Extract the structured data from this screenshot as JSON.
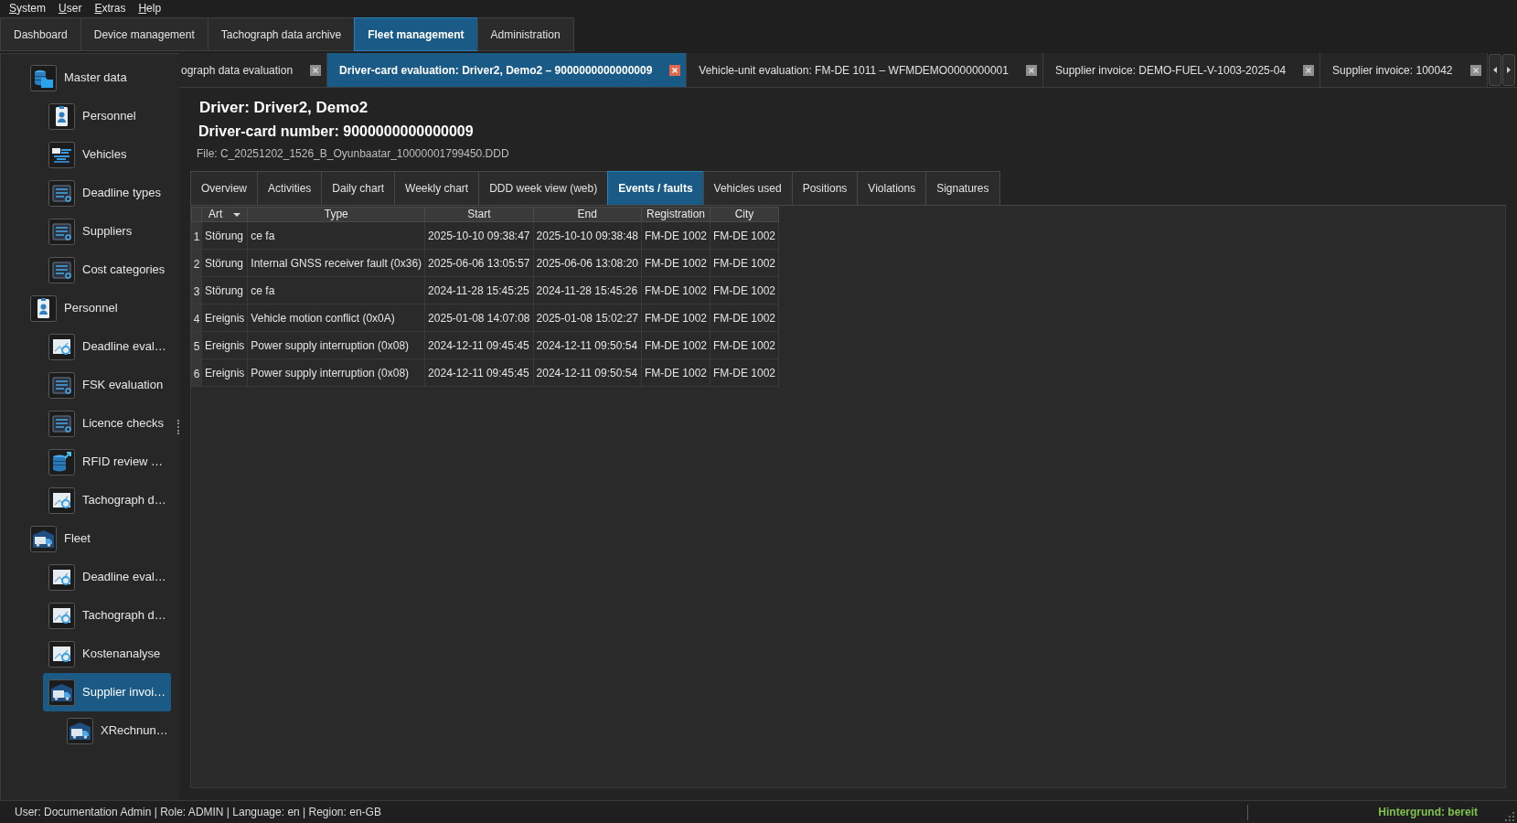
{
  "menu": [
    "System",
    "User",
    "Extras",
    "Help"
  ],
  "main_tabs": [
    {
      "label": "Dashboard",
      "selected": false
    },
    {
      "label": "Device management",
      "selected": false
    },
    {
      "label": "Tachograph data archive",
      "selected": false
    },
    {
      "label": "Fleet management",
      "selected": true
    },
    {
      "label": "Administration",
      "selected": false
    }
  ],
  "sidebar": {
    "items": [
      {
        "label": "Master data",
        "kind": "database",
        "selected": false,
        "children": [
          {
            "label": "Personnel",
            "kind": "badge",
            "selected": false
          },
          {
            "label": "Vehicles",
            "kind": "monitor",
            "selected": false
          },
          {
            "label": "Deadline types",
            "kind": "sliders",
            "selected": false
          },
          {
            "label": "Suppliers",
            "kind": "sliders",
            "selected": false
          },
          {
            "label": "Cost categories",
            "kind": "sliders",
            "selected": false
          }
        ]
      },
      {
        "label": "Personnel",
        "kind": "badge",
        "selected": false,
        "children": [
          {
            "label": "Deadline eval…",
            "kind": "chart",
            "selected": false
          },
          {
            "label": "FSK evaluation",
            "kind": "sliders",
            "selected": false
          },
          {
            "label": "Licence checks",
            "kind": "sliders",
            "selected": false
          },
          {
            "label": "RFID review …",
            "kind": "export",
            "selected": false
          },
          {
            "label": "Tachograph d…",
            "kind": "chart",
            "selected": false
          }
        ]
      },
      {
        "label": "Fleet",
        "kind": "truck",
        "selected": false,
        "children": [
          {
            "label": "Deadline eval…",
            "kind": "chart",
            "selected": false
          },
          {
            "label": "Tachograph d…",
            "kind": "chart",
            "selected": false
          },
          {
            "label": "Kostenanalyse",
            "kind": "chart",
            "selected": false
          },
          {
            "label": "Supplier invoi…",
            "kind": "truck",
            "selected": true,
            "children": [
              {
                "label": "XRechnun…",
                "kind": "truck",
                "selected": false
              }
            ]
          }
        ]
      }
    ]
  },
  "document_tabs": [
    {
      "label": "ograph data evaluation",
      "selected": false
    },
    {
      "label": "Driver-card evaluation: Driver2, Demo2 – 9000000000000009",
      "selected": true
    },
    {
      "label": "Vehicle-unit evaluation: FM-DE 1011 – WFMDEMO0000000001",
      "selected": false
    },
    {
      "label": "Supplier invoice: DEMO-FUEL-V-1003-2025-04",
      "selected": false
    },
    {
      "label": "Supplier invoice: 100042",
      "selected": false
    }
  ],
  "driver": {
    "title": "Driver: Driver2, Demo2",
    "card_number": "Driver-card number: 9000000000000009",
    "file": "File: C_20251202_1526_B_Oyunbaatar_10000001799450.DDD"
  },
  "view_tabs": [
    {
      "label": "Overview",
      "selected": false
    },
    {
      "label": "Activities",
      "selected": false
    },
    {
      "label": "Daily chart",
      "selected": false
    },
    {
      "label": "Weekly chart",
      "selected": false
    },
    {
      "label": "DDD week view (web)",
      "selected": false
    },
    {
      "label": "Events / faults",
      "selected": true
    },
    {
      "label": "Vehicles used",
      "selected": false
    },
    {
      "label": "Positions",
      "selected": false
    },
    {
      "label": "Violations",
      "selected": false
    },
    {
      "label": "Signatures",
      "selected": false
    }
  ],
  "table": {
    "columns": [
      {
        "label": "Art",
        "sorted": true
      },
      {
        "label": "Type",
        "sorted": false
      },
      {
        "label": "Start",
        "sorted": false
      },
      {
        "label": "End",
        "sorted": false
      },
      {
        "label": "Registration",
        "sorted": false
      },
      {
        "label": "City",
        "sorted": false
      }
    ],
    "rows": [
      {
        "number": "1",
        "cells": [
          "Störung",
          "ce fa",
          "2025-10-10 09:38:47",
          "2025-10-10 09:38:48",
          "FM-DE 1002",
          "FM-DE 1002"
        ]
      },
      {
        "number": "2",
        "cells": [
          "Störung",
          "Internal GNSS receiver fault (0x36)",
          "2025-06-06 13:05:57",
          "2025-06-06 13:08:20",
          "FM-DE 1002",
          "FM-DE 1002"
        ]
      },
      {
        "number": "3",
        "cells": [
          "Störung",
          "ce fa",
          "2024-11-28 15:45:25",
          "2024-11-28 15:45:26",
          "FM-DE 1002",
          "FM-DE 1002"
        ]
      },
      {
        "number": "4",
        "cells": [
          "Ereignis",
          "Vehicle motion conflict (0x0A)",
          "2025-01-08 14:07:08",
          "2025-01-08 15:02:27",
          "FM-DE 1002",
          "FM-DE 1002"
        ]
      },
      {
        "number": "5",
        "cells": [
          "Ereignis",
          "Power supply interruption (0x08)",
          "2024-12-11 09:45:45",
          "2024-12-11 09:50:54",
          "FM-DE 1002",
          "FM-DE 1002"
        ]
      },
      {
        "number": "6",
        "cells": [
          "Ereignis",
          "Power supply interruption (0x08)",
          "2024-12-11 09:45:45",
          "2024-12-11 09:50:54",
          "FM-DE 1002",
          "FM-DE 1002"
        ]
      }
    ]
  },
  "status_bar": {
    "info": "User: Documentation Admin | Role: ADMIN | Language: en | Region: en-GB",
    "background_task": "Hintergrund: bereit"
  }
}
